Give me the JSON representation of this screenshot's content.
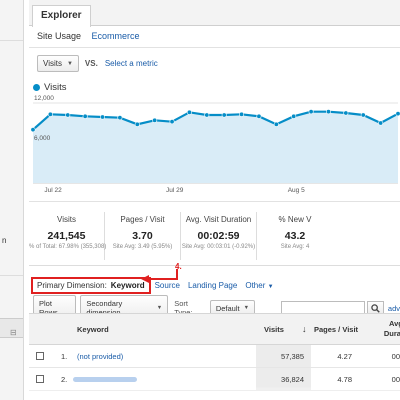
{
  "tabs": {
    "explorer": "Explorer"
  },
  "subtabs": {
    "site_usage": "Site Usage",
    "ecommerce": "Ecommerce"
  },
  "metric_select": {
    "value": "Visits",
    "vs": "VS.",
    "select_metric": "Select a metric"
  },
  "legend": {
    "series": "Visits",
    "color": "#058dc7"
  },
  "sidebar": {
    "partial_text": "n"
  },
  "chart_data": {
    "type": "area",
    "title": "",
    "series": [
      {
        "name": "Visits",
        "x": [
          "Jul 21",
          "Jul 22",
          "Jul 23",
          "Jul 24",
          "Jul 25",
          "Jul 26",
          "Jul 27",
          "Jul 28",
          "Jul 29",
          "Jul 30",
          "Jul 31",
          "Aug 1",
          "Aug 2",
          "Aug 3",
          "Aug 4",
          "Aug 5",
          "Aug 6",
          "Aug 7",
          "Aug 8",
          "Aug 9",
          "Aug 10",
          "Aug 11"
        ],
        "values": [
          8000,
          10300,
          10200,
          10000,
          9900,
          9800,
          8800,
          9400,
          9200,
          10600,
          10200,
          10200,
          10300,
          10000,
          8800,
          10000,
          10700,
          10700,
          10500,
          10200,
          9000,
          10400
        ]
      }
    ],
    "y_ticks": [
      "12,000",
      "6,000"
    ],
    "ylim": [
      0,
      12000
    ],
    "x_ticks": [
      "Jul 22",
      "Jul 29",
      "Aug 5"
    ],
    "grid": true,
    "color": "#058dc7"
  },
  "summary": [
    {
      "label": "Visits",
      "value": "241,545",
      "sub": "% of Total: 67.98% (355,308)"
    },
    {
      "label": "Pages / Visit",
      "value": "3.70",
      "sub": "Site Avg: 3.49 (5.95%)"
    },
    {
      "label": "Avg. Visit Duration",
      "value": "00:02:59",
      "sub": "Site Avg: 00:03:01 (-0.92%)"
    },
    {
      "label": "% New V",
      "value": "43.2",
      "sub": "Site Avg: 4"
    }
  ],
  "dimension": {
    "label": "Primary Dimension:",
    "active": "Keyword",
    "source": "Source",
    "landing_page": "Landing Page",
    "other": "Other",
    "annotation": "4."
  },
  "toolbar": {
    "plot_rows": "Plot Rows",
    "secondary_dimension": "Secondary dimension",
    "sort_type_label": "Sort Type:",
    "sort_type_value": "Default",
    "search_placeholder": "",
    "advanced": "adv"
  },
  "table": {
    "headers": {
      "keyword": "Keyword",
      "visits": "Visits",
      "pages_visit": "Pages / Visit",
      "avg_duration": "Avg. Duratio"
    },
    "sort_arrow": "↓",
    "rows": [
      {
        "index": "1.",
        "keyword": "(not provided)",
        "visits": "57,385",
        "pages_visit": "4.27",
        "duration": "00"
      },
      {
        "index": "2.",
        "keyword": "",
        "visits": "36,824",
        "pages_visit": "4.78",
        "duration": "00"
      }
    ]
  },
  "colors": {
    "accent": "#058dc7",
    "link": "#1a5ca8",
    "annotation": "#e02020"
  }
}
